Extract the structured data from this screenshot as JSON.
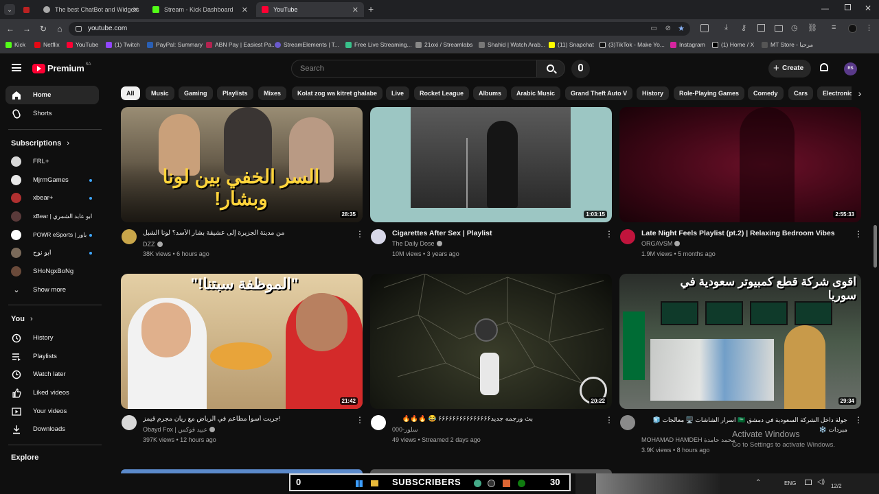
{
  "browser": {
    "tabs": [
      {
        "label": "The best ChatBot and Widgets",
        "active": false
      },
      {
        "label": "Stream - Kick Dashboard",
        "active": false
      },
      {
        "label": "YouTube",
        "active": true
      }
    ],
    "url": "youtube.com",
    "bookmarks": [
      "Kick",
      "Netflix",
      "YouTube",
      "(1) Twitch",
      "PayPal: Summary",
      "ABN Pay | Easiest Pa...",
      "StreamElements | T...",
      "Free Live Streaming...",
      "21oxi / Streamlabs",
      "Shahid | Watch Arab...",
      "(11) Snapchat",
      "(3)TikTok - Make Yo...",
      "Instagram",
      "(1) Home / X",
      "MT Store - مرحبا"
    ]
  },
  "header": {
    "logo": "Premium",
    "logo_badge": "SA",
    "search_placeholder": "Search",
    "create_label": "Create",
    "avatar_initials": "RS"
  },
  "sidebar": {
    "main": [
      {
        "label": "Home",
        "icon": "home-icon",
        "active": true
      },
      {
        "label": "Shorts",
        "icon": "shorts-icon",
        "active": false
      }
    ],
    "subscriptions_title": "Subscriptions",
    "subscriptions": [
      {
        "label": "FRL+",
        "color": "#d8d8d8",
        "dot": false
      },
      {
        "label": "MjrmGames",
        "color": "#e8e8e8",
        "dot": true
      },
      {
        "label": "xbear+",
        "color": "#b03030",
        "dot": true
      },
      {
        "label": "xBear | ابو عابد الشمري",
        "color": "#5a3a3a",
        "dot": false
      },
      {
        "label": "POWR eSports | باور",
        "color": "#ffffff",
        "dot": true
      },
      {
        "label": "ابو نوح",
        "color": "#7a6a5a",
        "dot": true
      },
      {
        "label": "SHoNgxBoNg",
        "color": "#6a4a3a",
        "dot": false
      }
    ],
    "show_more": "Show more",
    "you_title": "You",
    "you_items": [
      {
        "label": "History",
        "icon": "history-icon"
      },
      {
        "label": "Playlists",
        "icon": "playlists-icon"
      },
      {
        "label": "Watch later",
        "icon": "watch-later-icon"
      },
      {
        "label": "Liked videos",
        "icon": "thumbs-up-icon"
      },
      {
        "label": "Your videos",
        "icon": "your-videos-icon"
      },
      {
        "label": "Downloads",
        "icon": "download-icon"
      }
    ],
    "explore_title": "Explore"
  },
  "chips": [
    "All",
    "Music",
    "Gaming",
    "Playlists",
    "Mixes",
    "Kolat zog wa kitret ghalabe",
    "Live",
    "Rocket League",
    "Albums",
    "Arabic Music",
    "Grand Theft Auto V",
    "History",
    "Role-Playing Games",
    "Comedy",
    "Cars",
    "Electronic"
  ],
  "videos": [
    {
      "title": "من مدينة الجزيرة إلى عشيقة بشار الأسد؟ لونا الشبل",
      "channel": "DZZ",
      "verified": true,
      "meta": "38K views • 6 hours ago",
      "duration": "28:35",
      "thumb_text": "السر الخفي بين لونا وبشار!",
      "bg": "#7a6a55",
      "avatar": "#c9a64a"
    },
    {
      "title": "Cigarettes After Sex | Playlist",
      "channel": "The Daily Dose",
      "verified": true,
      "meta": "10M views • 3 years ago",
      "duration": "1:03:15",
      "thumb_text": "",
      "bg": "#9cc6c3",
      "avatar": "#d7d7e8"
    },
    {
      "title": "Late Night Feels Playlist (pt.2) | Relaxing Bedroom Vibes",
      "channel": "ORGAVSM",
      "verified": true,
      "meta": "1.9M views • 5 months ago",
      "duration": "2:55:33",
      "thumb_text": "",
      "bg": "#4a0a1a",
      "avatar": "#c0143c"
    },
    {
      "title": "جربت أسوأ مطاعم في الرياض مع ريان مجرم قيمز!",
      "channel": "Obayd Fox | عبيد فوكس",
      "verified": true,
      "meta": "397K views • 12 hours ago",
      "duration": "21:42",
      "thumb_text": "\"الموظفة سبتنا!\"",
      "bg": "#d8c4a0",
      "avatar": "#d8d8d8"
    },
    {
      "title": "بث ورجمه جديد۶۶۶۶۶۶۶۶۶۶۶۶۶۶۶ 😂 🔥🔥🔥",
      "channel": "سلور-000",
      "verified": false,
      "meta": "49 views • Streamed 2 days ago",
      "duration": "20:22",
      "thumb_text": "",
      "bg": "#20241e",
      "avatar": "#ffffff"
    },
    {
      "title": "جولة داخل الشركة السعودية في دمشق 🇸🇦 اسرار الشاشات 🖥️ معالجات 🧊 مبردات ❄️",
      "channel": "MOHAMAD HAMDEH محمد حامدة",
      "verified": false,
      "meta": "3.9K views • 8 hours ago",
      "duration": "29:34",
      "thumb_text": "اقوى شركة قطع كمبيوتر سعودية في سوريا",
      "bg": "#3a4a3a",
      "avatar": "#8a8a8a"
    }
  ],
  "overlay": {
    "activate_title": "Activate Windows",
    "activate_sub": "Go to Settings to activate Windows.",
    "subs_left": "0",
    "subs_label": "SUBSCRIBERS",
    "subs_right": "30",
    "lang": "ENG",
    "date": "12/2"
  }
}
